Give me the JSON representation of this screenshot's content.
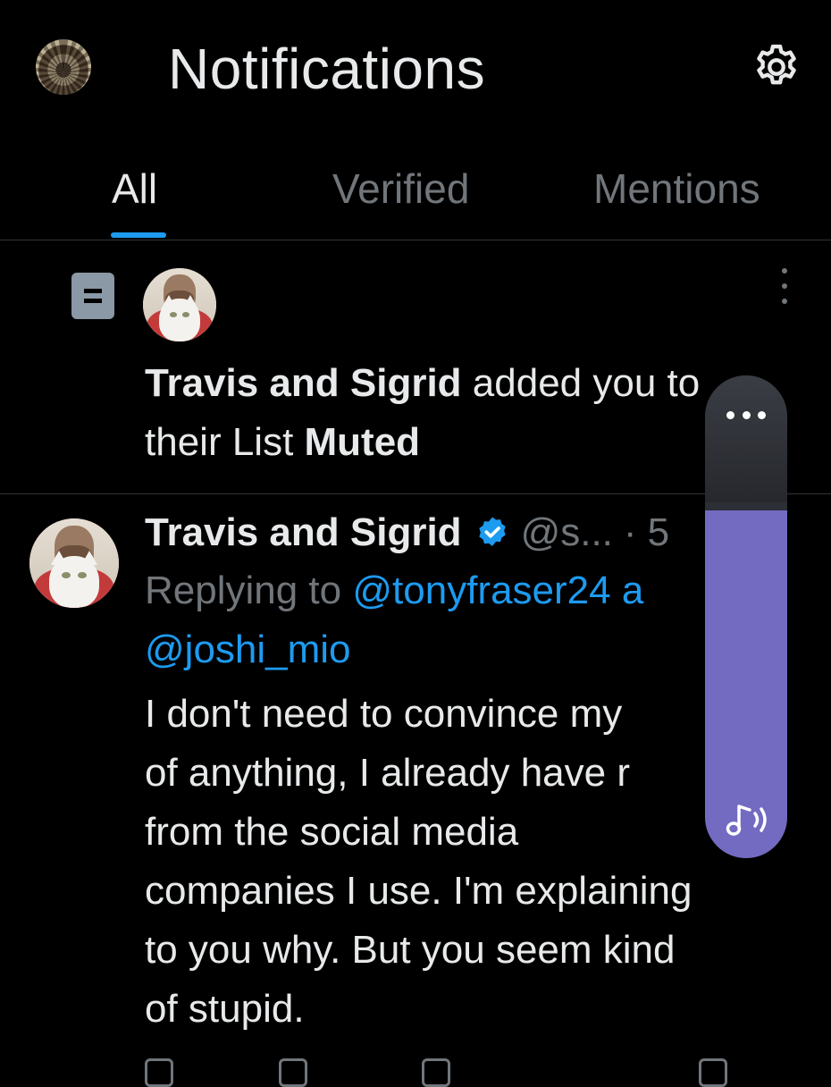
{
  "header": {
    "title": "Notifications",
    "avatar_icon": "profile-avatar",
    "settings_icon": "gear-icon"
  },
  "tabs": [
    {
      "label": "All",
      "active": true
    },
    {
      "label": "Verified",
      "active": false
    },
    {
      "label": "Mentions",
      "active": false
    }
  ],
  "colors": {
    "accent": "#1d9bf0",
    "secondary_text": "#71767b",
    "primary_text": "#e7e9ea",
    "volume_fill": "#736bc2"
  },
  "notification": {
    "icon": "list-icon",
    "actor": "Travis and Sigrid",
    "action_text": "added you to",
    "line2_prefix": "their List",
    "list_name": "Muted",
    "menu_icon": "more-vertical-icon"
  },
  "tweet": {
    "author_name": "Travis and Sigrid",
    "verified": true,
    "handle": "@s...",
    "separator": "·",
    "time": "5",
    "reply_prefix": "Replying to",
    "reply_mention_1": "@tonyfraser24",
    "reply_mention_1_tail": "a",
    "reply_mention_2": "@joshi_mio",
    "body_lines": [
      "I don't need to convince my",
      "of anything, I already have r",
      "from the social media",
      "companies I use. I'm explaining",
      "to you why. But you seem kind",
      "of stupid."
    ]
  },
  "volume_overlay": {
    "more_icon": "more-horizontal-icon",
    "media_icon": "music-volume-icon",
    "level": 0.72
  }
}
